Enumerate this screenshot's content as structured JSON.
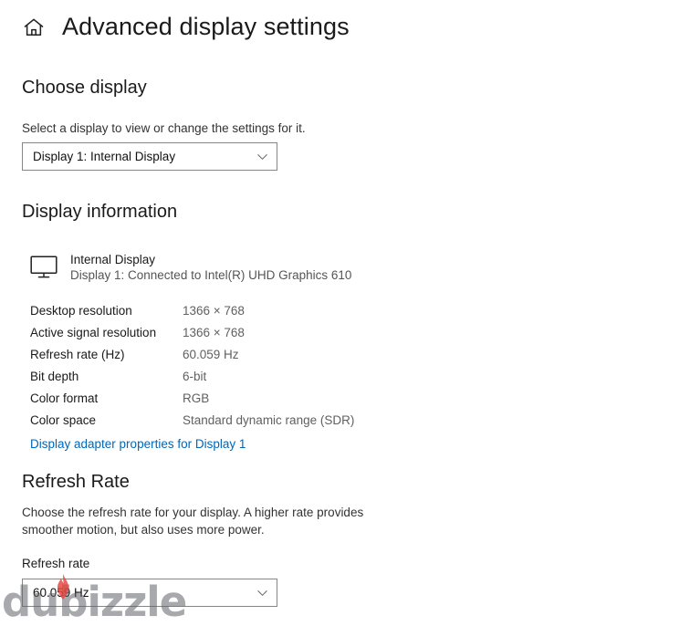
{
  "header": {
    "home_icon": "home-icon",
    "title": "Advanced display settings"
  },
  "choose_display": {
    "heading": "Choose display",
    "description": "Select a display to view or change the settings for it.",
    "selected": "Display 1: Internal Display",
    "chevron_icon": "chevron-down-icon"
  },
  "display_information": {
    "heading": "Display information",
    "monitor_icon": "monitor-icon",
    "monitor_name": "Internal Display",
    "monitor_connection": "Display 1: Connected to Intel(R) UHD Graphics 610",
    "specs": [
      {
        "label": "Desktop resolution",
        "value": "1366 × 768"
      },
      {
        "label": "Active signal resolution",
        "value": "1366 × 768"
      },
      {
        "label": "Refresh rate (Hz)",
        "value": "60.059 Hz"
      },
      {
        "label": "Bit depth",
        "value": "6-bit"
      },
      {
        "label": "Color format",
        "value": "RGB"
      },
      {
        "label": "Color space",
        "value": "Standard dynamic range (SDR)"
      }
    ],
    "adapter_link": "Display adapter properties for Display 1"
  },
  "refresh_rate": {
    "heading": "Refresh Rate",
    "description": "Choose the refresh rate for your display. A higher rate provides smoother motion, but also uses more power.",
    "field_label": "Refresh rate",
    "selected": "60.059 Hz",
    "chevron_icon": "chevron-down-icon"
  },
  "watermark": {
    "text": "dubizzle",
    "flame_icon": "flame-icon"
  },
  "colors": {
    "accent_link": "#0067b8",
    "text_primary": "#1a1a1a",
    "text_secondary": "#606060",
    "combo_border": "#868686",
    "watermark_flame": "#e8433c",
    "background": "#ffffff"
  }
}
